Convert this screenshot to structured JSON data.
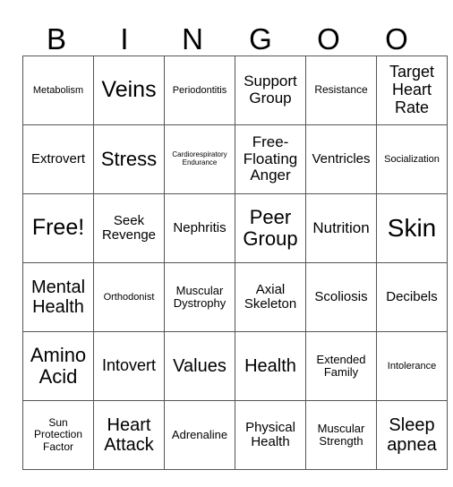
{
  "header": [
    "B",
    "I",
    "N",
    "G",
    "O",
    "O"
  ],
  "rows": [
    [
      "Metabolism",
      "Veins",
      "Periodontitis",
      "Support Group",
      "Resistance",
      "Target Heart Rate"
    ],
    [
      "Extrovert",
      "Stress",
      "Cardiorespiratory Endurance",
      "Free-Floating Anger",
      "Ventricles",
      "Socialization"
    ],
    [
      "Free!",
      "Seek Revenge",
      "Nephritis",
      "Peer Group",
      "Nutrition",
      "Skin"
    ],
    [
      "Mental Health",
      "Orthodonist",
      "Muscular Dystrophy",
      "Axial Skeleton",
      "Scoliosis",
      "Decibels"
    ],
    [
      "Amino Acid",
      "Intovert",
      "Values",
      "Health",
      "Extended Family",
      "Intolerance"
    ],
    [
      "Sun Protection Factor",
      "Heart Attack",
      "Adrenaline",
      "Physical Health",
      "Muscular Strength",
      "Sleep apnea"
    ]
  ]
}
